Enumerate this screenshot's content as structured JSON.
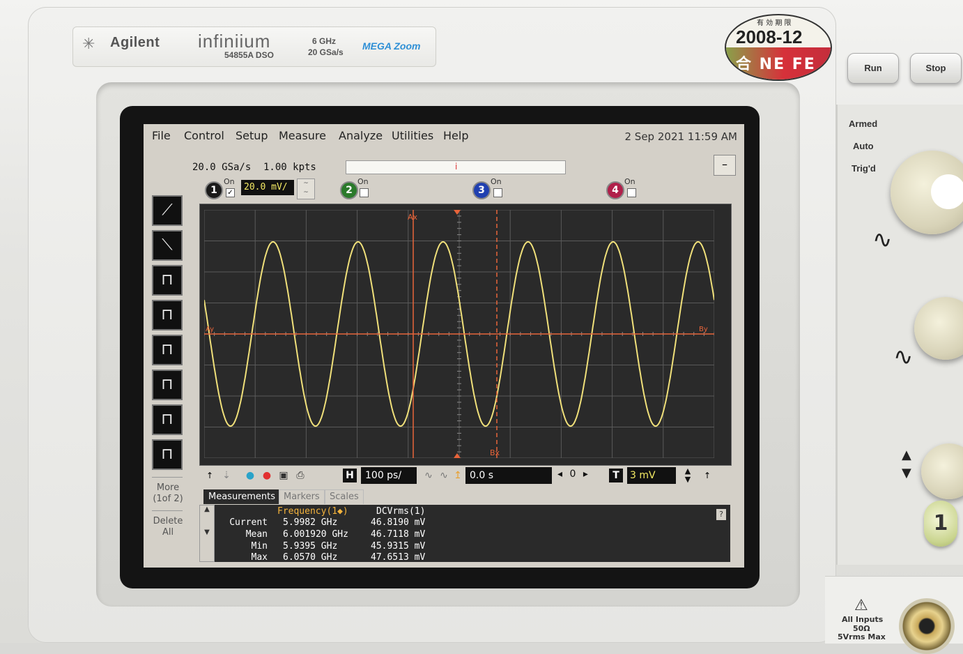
{
  "instrument": {
    "brand": "Agilent",
    "series": "infiniium",
    "model": "54855A DSO",
    "spec_bandwidth": "6 GHz",
    "spec_rate": "20 GSa/s",
    "feature": "MEGA Zoom",
    "sticker_date": "2008-12",
    "sticker_kanji": "有 効 期 限",
    "sticker_label": "合 NE FE 格",
    "run_label": "Run",
    "stop_label": "Stop",
    "trigger_status": [
      "Armed",
      "Auto",
      "Trig'd"
    ],
    "channel_button": "1",
    "input_warning": [
      "All Inputs",
      "50Ω",
      "5Vrms Max"
    ]
  },
  "menu": [
    "File",
    "Control",
    "Setup",
    "Measure",
    "Analyze",
    "Utilities",
    "Help"
  ],
  "datetime": "2 Sep 2021 11:59 AM",
  "acquisition": {
    "sample_rate": "20.0 GSa/s",
    "memory_depth": "1.00 kpts"
  },
  "channels": [
    {
      "id": "1",
      "on_label": "On",
      "checked": true,
      "scale": "20.0 mV/",
      "color": "#1a1a1a"
    },
    {
      "id": "2",
      "on_label": "On",
      "checked": false,
      "color": "#2b7a2b"
    },
    {
      "id": "3",
      "on_label": "On",
      "checked": false,
      "color": "#2040b0"
    },
    {
      "id": "4",
      "on_label": "On",
      "checked": false,
      "color": "#b0204a"
    }
  ],
  "toolbar": {
    "more_label": "More (1of 2)",
    "delete_label": "Delete All"
  },
  "timebase": {
    "h_label": "H",
    "scale": "100 ps/",
    "delay": "0.0 s",
    "position": "0"
  },
  "trigger": {
    "t_label": "T",
    "level": "3 mV"
  },
  "markers": {
    "ax": "Ax",
    "bx": "Bx",
    "ay": "Ay",
    "by": "By"
  },
  "tabs": [
    "Measurements",
    "Markers",
    "Scales"
  ],
  "measurements": {
    "columns": [
      "",
      "Frequency(1◆)",
      "DCVrms(1)"
    ],
    "rows": [
      {
        "label": "Current",
        "frequency": "5.9982 GHz",
        "dcvrms": "46.8190 mV"
      },
      {
        "label": "Mean",
        "frequency": "6.001920 GHz",
        "dcvrms": "46.7118 mV"
      },
      {
        "label": "Min",
        "frequency": "5.9395 GHz",
        "dcvrms": "45.9315 mV"
      },
      {
        "label": "Max",
        "frequency": "6.0570 GHz",
        "dcvrms": "47.6513 mV"
      }
    ]
  },
  "colors": {
    "trace": "#f0e07a",
    "marker": "#e8643a",
    "screen_bg": "#2a2a2a",
    "grid": "#5a5a5a"
  },
  "waveform": {
    "cycles_visible": 6,
    "amplitude_divs": 3.6,
    "divisions_x": 10,
    "divisions_y": 8
  }
}
